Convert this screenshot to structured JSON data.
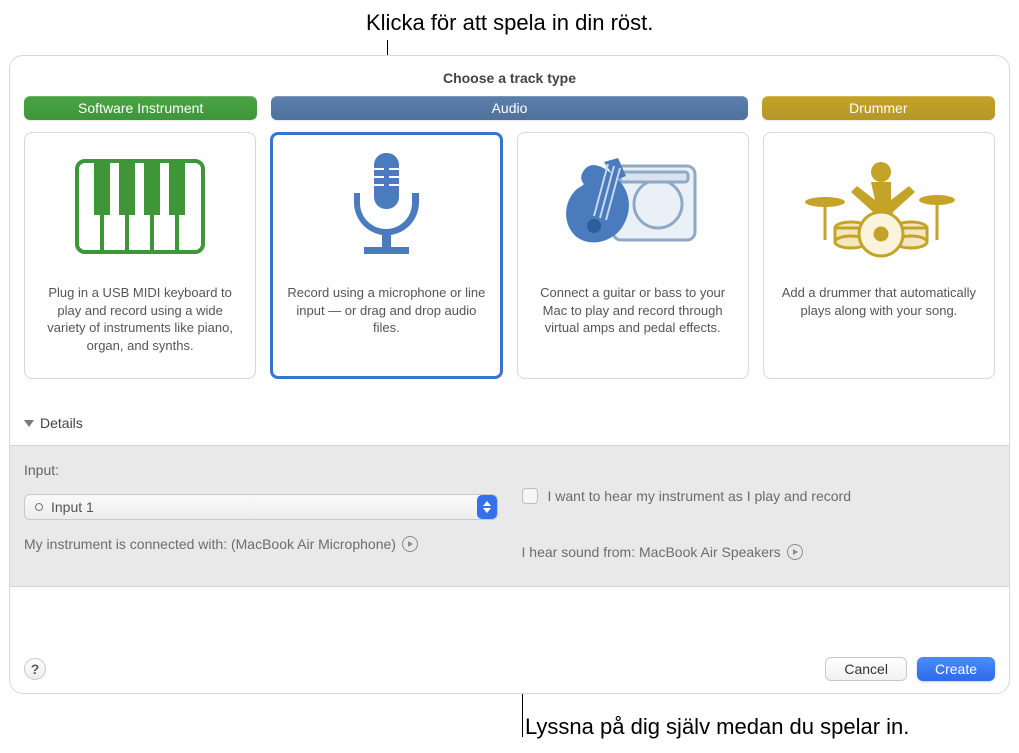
{
  "callouts": {
    "top": "Klicka för att spela in din röst.",
    "bottom": "Lyssna på dig själv medan du spelar in."
  },
  "dialog": {
    "title": "Choose a track type",
    "pills": {
      "software": "Software Instrument",
      "audio": "Audio",
      "drummer": "Drummer"
    },
    "cards": [
      {
        "name": "software",
        "desc": "Plug in a USB MIDI keyboard to play and record using a wide variety of instruments like piano, organ, and synths."
      },
      {
        "name": "audio-mic",
        "desc": "Record using a microphone or line input — or drag and drop audio files."
      },
      {
        "name": "audio-guitar",
        "desc": "Connect a guitar or bass to your Mac to play and record through virtual amps and pedal effects."
      },
      {
        "name": "drummer",
        "desc": "Add a drummer that automatically plays along with your song."
      }
    ],
    "details_label": "Details",
    "input": {
      "label": "Input:",
      "value": "Input 1",
      "connected_prefix": "My instrument is connected with: ",
      "connected_device": "(MacBook Air Microphone)"
    },
    "monitor": {
      "checkbox_label": "I want to hear my instrument as I play and record",
      "hear_prefix": "I hear sound from: ",
      "hear_device": "MacBook Air Speakers"
    },
    "footer": {
      "help": "?",
      "cancel": "Cancel",
      "create": "Create"
    }
  }
}
